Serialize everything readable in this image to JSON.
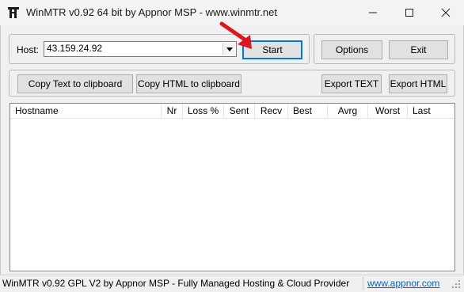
{
  "window": {
    "title": "WinMTR v0.92 64 bit by Appnor MSP - www.winmtr.net",
    "controls": [
      "minimize-icon",
      "maximize-icon",
      "close-icon"
    ]
  },
  "host": {
    "label": "Host:",
    "value": "43.159.24.92"
  },
  "buttons": {
    "start": "Start",
    "options": "Options",
    "exit": "Exit",
    "copy_text": "Copy Text to clipboard",
    "copy_html": "Copy HTML to clipboard",
    "export_text": "Export TEXT",
    "export_html": "Export HTML"
  },
  "table": {
    "columns": [
      "Hostname",
      "Nr",
      "Loss %",
      "Sent",
      "Recv",
      "Best",
      "Avrg",
      "Worst",
      "Last"
    ],
    "rows": []
  },
  "status": {
    "text": "WinMTR v0.92 GPL V2 by Appnor MSP - Fully Managed Hosting & Cloud Provider",
    "link": "www.appnor.com"
  },
  "colors": {
    "annotation_arrow": "#e0141c",
    "focus_border": "#0078d7",
    "link": "#0066cc"
  }
}
